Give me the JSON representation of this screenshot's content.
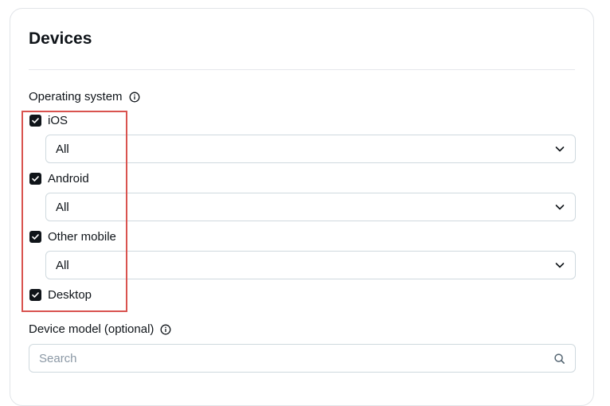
{
  "section": {
    "title": "Devices"
  },
  "operating_system": {
    "label": "Operating system",
    "info_icon": "info-icon",
    "options": [
      {
        "label": "iOS",
        "checked": true,
        "select_value": "All"
      },
      {
        "label": "Android",
        "checked": true,
        "select_value": "All"
      },
      {
        "label": "Other mobile",
        "checked": true,
        "select_value": "All"
      },
      {
        "label": "Desktop",
        "checked": true
      }
    ]
  },
  "device_model": {
    "label": "Device model",
    "optional": "(optional)",
    "search_placeholder": "Search",
    "search_value": ""
  },
  "colors": {
    "text": "#0f1419",
    "border": "#cfd9de",
    "highlight": "#d9534f",
    "checkbox": "#0f1419"
  }
}
